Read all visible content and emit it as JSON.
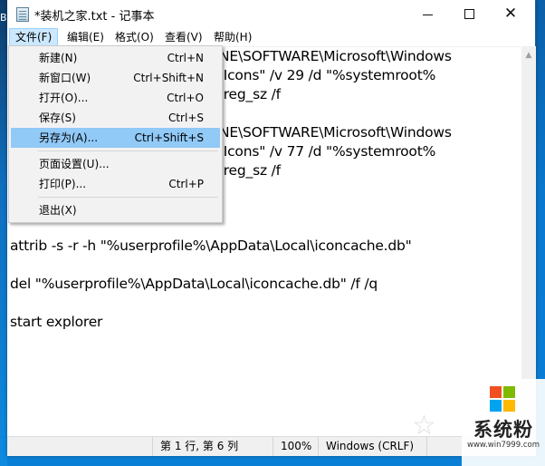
{
  "desktop": {
    "edge_text": "B."
  },
  "window": {
    "title": "*装机之家.txt - 记事本",
    "controls": {
      "minimize": "—",
      "maximize": "□",
      "close": "✕"
    }
  },
  "menubar": {
    "items": [
      {
        "label": "文件(F)",
        "active": true
      },
      {
        "label": "编辑(E)"
      },
      {
        "label": "格式(O)"
      },
      {
        "label": "查看(V)"
      },
      {
        "label": "帮助(H)"
      }
    ]
  },
  "file_menu": {
    "items": [
      {
        "label": "新建(N)",
        "shortcut": "Ctrl+N"
      },
      {
        "label": "新窗口(W)",
        "shortcut": "Ctrl+Shift+N"
      },
      {
        "label": "打开(O)...",
        "shortcut": "Ctrl+O"
      },
      {
        "label": "保存(S)",
        "shortcut": "Ctrl+S"
      },
      {
        "label": "另存为(A)...",
        "shortcut": "Ctrl+Shift+S",
        "highlighted": true
      },
      {
        "label": "页面设置(U)...",
        "shortcut": ""
      },
      {
        "label": "打印(P)...",
        "shortcut": "Ctrl+P"
      },
      {
        "label": "退出(X)",
        "shortcut": ""
      }
    ]
  },
  "editor": {
    "visible_lines": [
      "NE\\SOFTWARE\\Microsoft\\Windows",
      " Icons\" /v 29 /d \"%systemroot%",
      " reg_sz /f",
      "NE\\SOFTWARE\\Microsoft\\Windows",
      " Icons\" /v 77 /d \"%systemroot%",
      " reg_sz /f",
      "attrib -s -r -h \"%userprofile%\\AppData\\Local\\iconcache.db\"",
      "del \"%userprofile%\\AppData\\Local\\iconcache.db\" /f /q",
      "start explorer"
    ]
  },
  "statusbar": {
    "position": "第 1 行, 第 6 列",
    "zoom": "100%",
    "line_ending": "Windows (CRLF)"
  },
  "watermark": {
    "name": "系统粉",
    "url": "www.win7999.com",
    "logo_colors": [
      "#f25022",
      "#7fba00",
      "#00a4ef",
      "#ffb900"
    ]
  }
}
